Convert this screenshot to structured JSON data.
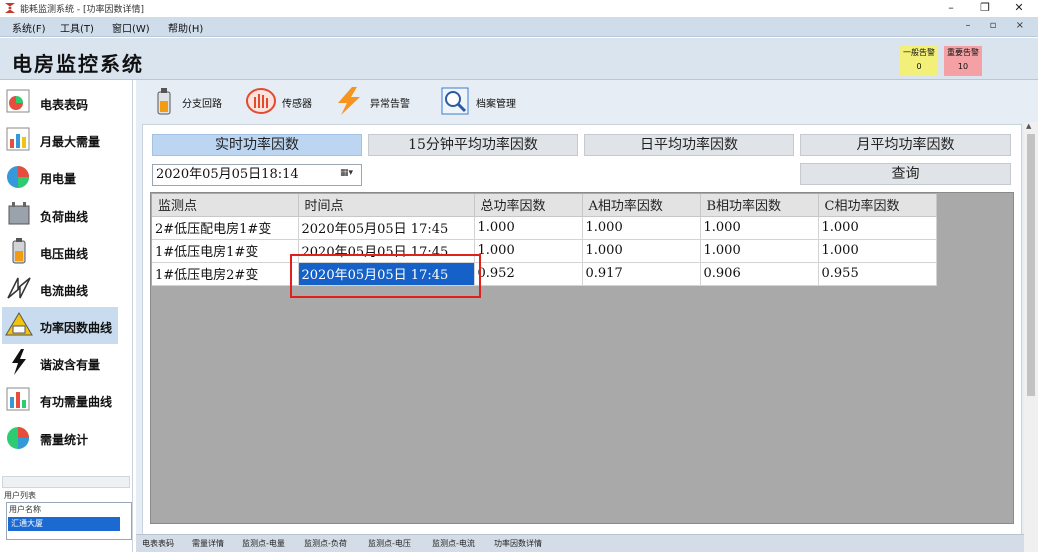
{
  "window": {
    "title": "能耗监测系统 - [功率因数详情]",
    "controls": [
      "–",
      "❐",
      "✕"
    ]
  },
  "menu": {
    "items": [
      "系统(F)",
      "工具(T)",
      "窗口(W)",
      "帮助(H)"
    ],
    "mdi_controls": "– ▫ ×"
  },
  "header": {
    "app_title": "电房监控系统",
    "alarm_normal": {
      "label": "一般告警",
      "count": "0",
      "color": "#f2f079"
    },
    "alarm_severe": {
      "label": "重要告警",
      "count": "10",
      "color": "#f4a0a4"
    }
  },
  "sidebar": {
    "items": [
      {
        "label": "电表表码",
        "icon": "meter-chart-icon"
      },
      {
        "label": "月最大需量",
        "icon": "bar-chart-icon"
      },
      {
        "label": "用电量",
        "icon": "pie-chart-icon"
      },
      {
        "label": "负荷曲线",
        "icon": "transformer-icon"
      },
      {
        "label": "电压曲线",
        "icon": "battery-icon"
      },
      {
        "label": "电流曲线",
        "icon": "current-icon"
      },
      {
        "label": "功率因数曲线",
        "icon": "warning-meter-icon"
      },
      {
        "label": "谐波含有量",
        "icon": "lightning-icon"
      },
      {
        "label": "有功需量曲线",
        "icon": "bar-chart-icon"
      },
      {
        "label": "需量统计",
        "icon": "pie-chart-icon"
      }
    ],
    "active_index": 6,
    "user_panel_title": "用户列表",
    "user_column": "用户名称",
    "user_selected": "汇通大厦"
  },
  "toolbar": {
    "items": [
      {
        "label": "分支回路",
        "icon": "branch-circuit-icon"
      },
      {
        "label": "传感器",
        "icon": "sensor-icon"
      },
      {
        "label": "异常告警",
        "icon": "alarm-icon"
      },
      {
        "label": "档案管理",
        "icon": "archive-search-icon"
      }
    ]
  },
  "tabs": {
    "items": [
      "实时功率因数",
      "15分钟平均功率因数",
      "日平均功率因数",
      "月平均功率因数"
    ],
    "active_index": 0
  },
  "filter": {
    "datetime": "2020年05月05日18:14",
    "query_label": "查询"
  },
  "grid": {
    "columns": [
      "监测点",
      "时间点",
      "总功率因数",
      "A相功率因数",
      "B相功率因数",
      "C相功率因数"
    ],
    "rows": [
      [
        "2#低压配电房1#变",
        "2020年05月05日 17:45",
        "1.000",
        "1.000",
        "1.000",
        "1.000"
      ],
      [
        "1#低压电房1#变",
        "2020年05月05日 17:45",
        "1.000",
        "1.000",
        "1.000",
        "1.000"
      ],
      [
        "1#低压电房2#变",
        "2020年05月05日 17:45",
        "0.952",
        "0.917",
        "0.906",
        "0.955"
      ]
    ],
    "selected_cell": {
      "row": 2,
      "col": 1
    }
  },
  "bottom_tabs": [
    "电表表码",
    "需量详情",
    "监测点-电量",
    "监测点-负荷",
    "监测点-电压",
    "监测点-电流",
    "功率因数详情"
  ]
}
